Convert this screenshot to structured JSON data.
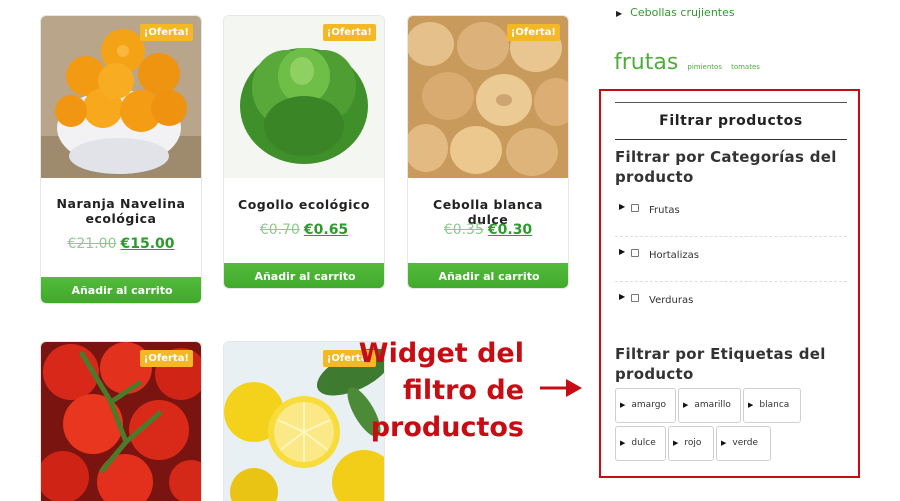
{
  "products": [
    {
      "name": "Naranja Navelina ecológica",
      "old_price": "€21.00",
      "new_price": "€15.00",
      "badge": "¡Oferta!",
      "image": "oranges-image",
      "button": "Añadir al carrito"
    },
    {
      "name": "Cogollo ecológico",
      "old_price": "€0.70",
      "new_price": "€0.65",
      "badge": "¡Oferta!",
      "image": "lettuce-image",
      "button": "Añadir al carrito"
    },
    {
      "name": "Cebolla blanca dulce",
      "old_price": "€0.35",
      "new_price": "€0.30",
      "badge": "¡Oferta!",
      "image": "onions-image",
      "button": "Añadir al carrito"
    },
    {
      "badge": "¡Oferta!",
      "image": "tomatoes-image"
    },
    {
      "badge": "¡Oferta!",
      "image": "lemons-image"
    }
  ],
  "sidebar": {
    "top_link": "Cebollas crujientes",
    "tagcloud": {
      "big": "frutas",
      "small1": "pimientos",
      "small2": "tomates"
    }
  },
  "widget": {
    "title": "Filtrar productos",
    "categories_title": "Filtrar por Categorías del producto",
    "categories": [
      "Frutas",
      "Hortalizas",
      "Verduras"
    ],
    "tags_title": "Filtrar por Etiquetas del producto",
    "tags": [
      "amargo",
      "amarillo",
      "blanca",
      "dulce",
      "rojo",
      "verde"
    ]
  },
  "annotation": {
    "line1": "Widget del",
    "line2": "filtro de",
    "line3": "productos",
    "color": "#c80c14"
  },
  "colors": {
    "accent_green": "#3fa92a",
    "badge_yellow": "#f3b824",
    "highlight_red": "#c80c14"
  }
}
